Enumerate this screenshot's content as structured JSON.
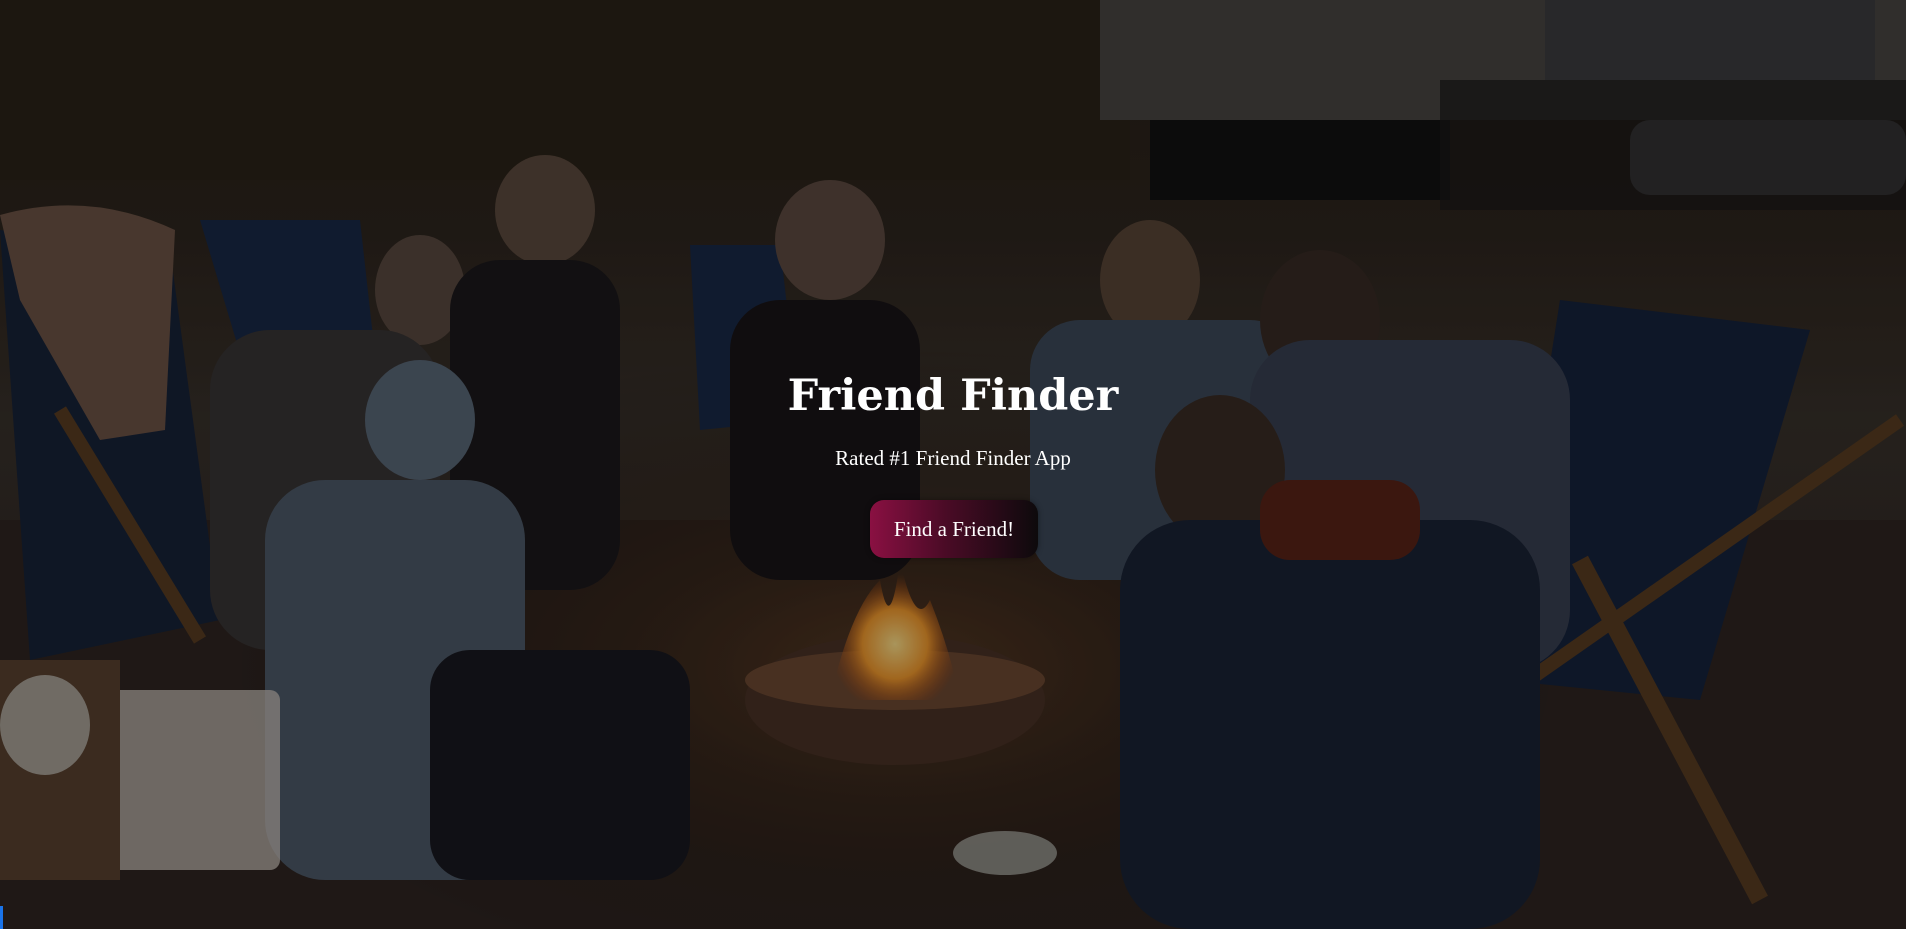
{
  "hero": {
    "title": "Friend Finder",
    "subtitle": "Rated #1 Friend Finder App",
    "cta_label": "Find a Friend!"
  },
  "colors": {
    "cta_gradient_start": "#8a1042",
    "cta_gradient_end": "#0d0a0c",
    "text": "#ffffff"
  }
}
